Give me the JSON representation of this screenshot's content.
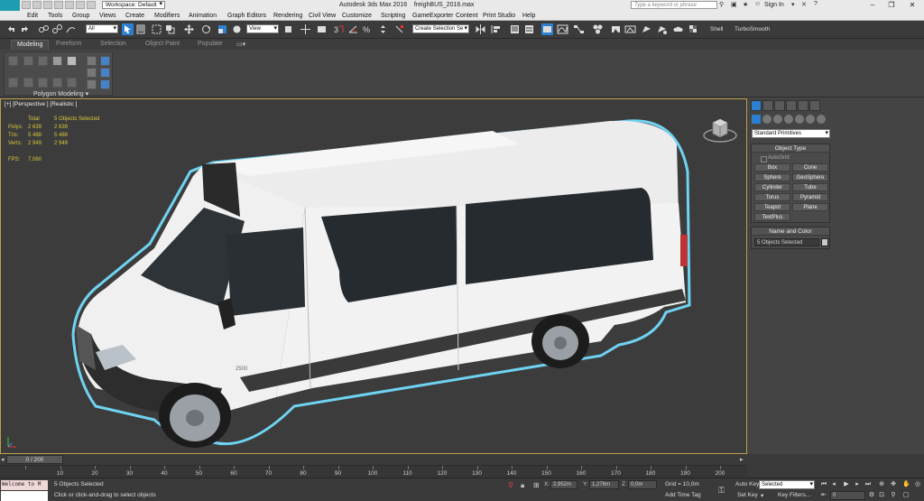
{
  "titlebar": {
    "logo": "MAX",
    "workspace": "Workspace: Default",
    "app_title": "Autodesk 3ds Max 2016",
    "file_name": "freighBUS_2016.max",
    "search_placeholder": "Type a keyword or phrase",
    "signin": "Sign In"
  },
  "menubar": {
    "items": [
      "Edit",
      "Tools",
      "Group",
      "Views",
      "Create",
      "Modifiers",
      "Animation",
      "Graph Editors",
      "Rendering",
      "Civil View",
      "Customize",
      "Scripting",
      "GameExporter",
      "Content",
      "Print Studio",
      "Help"
    ]
  },
  "toolbar": {
    "filter": "All",
    "ref_coord": "View",
    "selection_set": "Create Selection Se",
    "shell": "Shell",
    "turbosmooth": "TurboSmooth"
  },
  "ribbon": {
    "tabs": [
      "Modeling",
      "Freeform",
      "Selection",
      "Object Paint",
      "Populate"
    ],
    "active_tab": "Modeling",
    "panel_title": "Polygon Modeling ▾"
  },
  "viewport": {
    "label": "[+] [Perspective ] [Realistic ]",
    "stats": {
      "header_total": "Total",
      "header_selected": "5 Objects Selected",
      "rows": [
        {
          "label": "Polys:",
          "total": "2 639",
          "selected": "2 639"
        },
        {
          "label": "Tris:",
          "total": "5 488",
          "selected": "5 488"
        },
        {
          "label": "Verts:",
          "total": "2 949",
          "selected": "2 949"
        }
      ],
      "fps_label": "FPS:",
      "fps_value": "7,060"
    },
    "model_text": "2500"
  },
  "command_panel": {
    "category": "Standard Primitives",
    "object_type_title": "Object Type",
    "autogrid": "AutoGrid",
    "primitives": [
      "Box",
      "Cone",
      "Sphere",
      "GeoSphere",
      "Cylinder",
      "Tube",
      "Torus",
      "Pyramid",
      "Teapot",
      "Plane",
      "TextPlus"
    ],
    "name_color_title": "Name and Color",
    "name_value": "5 Objects Selected"
  },
  "timeline": {
    "frame_display": "0 / 200",
    "ticks": [
      "0",
      "10",
      "20",
      "30",
      "40",
      "50",
      "60",
      "70",
      "80",
      "90",
      "100",
      "110",
      "120",
      "130",
      "140",
      "150",
      "160",
      "170",
      "180",
      "190",
      "200"
    ]
  },
  "statusbar": {
    "maxscript": "Welcome to M",
    "selection_status": "5 Objects Selected",
    "prompt": "Click or click-and-drag to select objects",
    "x_label": "X:",
    "x_value": "2,952m",
    "y_label": "Y:",
    "y_value": "1,276m",
    "z_label": "Z:",
    "z_value": "0,0m",
    "grid": "Grid = 10,0m",
    "add_time_tag": "Add Time Tag",
    "auto_key": "Auto Key",
    "set_key": "Set Key",
    "selected_dropdown": "Selected",
    "key_filters": "Key Filters...",
    "current_frame": "0"
  },
  "colors": {
    "accent": "#2d7fd1",
    "viewport_border": "#b8a048",
    "stats_text": "#d8c83a",
    "selection_outline": "#6fd3f2"
  }
}
